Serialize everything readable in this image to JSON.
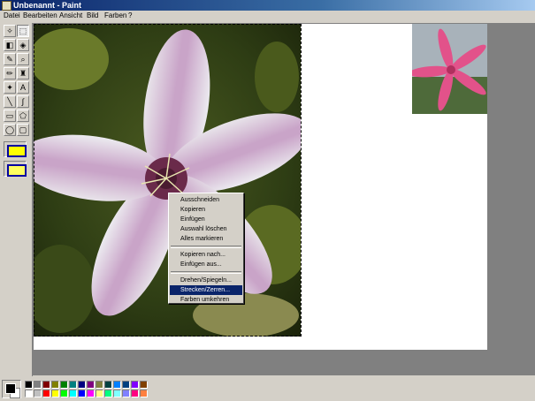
{
  "window": {
    "title": "Unbenannt - Paint"
  },
  "menu": [
    "Datei",
    "Bearbeiten",
    "Ansicht",
    "Bild",
    "Farben",
    "?"
  ],
  "tools": [
    {
      "icon": "free-form-select-icon",
      "glyph": "✧"
    },
    {
      "icon": "rect-select-icon",
      "glyph": "⬚",
      "pressed": true
    },
    {
      "icon": "eraser-icon",
      "glyph": "◧"
    },
    {
      "icon": "fill-bucket-icon",
      "glyph": "◈"
    },
    {
      "icon": "pick-color-icon",
      "glyph": "✎"
    },
    {
      "icon": "magnifier-icon",
      "glyph": "⌕"
    },
    {
      "icon": "pencil-icon",
      "glyph": "✏"
    },
    {
      "icon": "brush-icon",
      "glyph": "♜"
    },
    {
      "icon": "airbrush-icon",
      "glyph": "✦"
    },
    {
      "icon": "text-icon",
      "glyph": "A"
    },
    {
      "icon": "line-icon",
      "glyph": "╲"
    },
    {
      "icon": "curve-icon",
      "glyph": "∫"
    },
    {
      "icon": "rectangle-icon",
      "glyph": "▭"
    },
    {
      "icon": "polygon-icon",
      "glyph": "⬠"
    },
    {
      "icon": "ellipse-icon",
      "glyph": "◯"
    },
    {
      "icon": "rounded-rect-icon",
      "glyph": "▢"
    }
  ],
  "context_menu": {
    "groups": [
      [
        "Ausschneiden",
        "Kopieren",
        "Einfügen",
        "Auswahl löschen",
        "Alles markieren"
      ],
      [
        "Kopieren nach...",
        "Einfügen aus..."
      ],
      [
        "Drehen/Spiegeln...",
        "Strecken/Zerren...",
        "Farben umkehren"
      ]
    ],
    "selected": "Strecken/Zerren..."
  },
  "palette": {
    "foreground": "#000000",
    "background": "#ffffff",
    "top_row": [
      "#000000",
      "#808080",
      "#800000",
      "#808000",
      "#008000",
      "#008080",
      "#000080",
      "#800080",
      "#808040",
      "#004040",
      "#0080ff",
      "#004080",
      "#8000ff",
      "#804000"
    ],
    "bottom_row": [
      "#ffffff",
      "#c0c0c0",
      "#ff0000",
      "#ffff00",
      "#00ff00",
      "#00ffff",
      "#0000ff",
      "#ff00ff",
      "#ffff80",
      "#00ff80",
      "#80ffff",
      "#8080ff",
      "#ff0080",
      "#ff8040"
    ]
  }
}
